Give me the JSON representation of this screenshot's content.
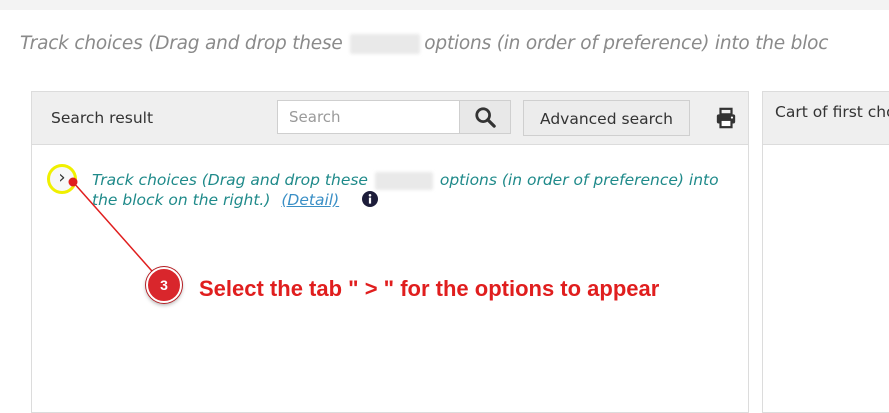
{
  "header": {
    "instruction_before": "Track choices (Drag and drop these",
    "instruction_after": "options (in order of preference) into the bloc"
  },
  "left_panel": {
    "title": "Search result",
    "search_placeholder": "Search",
    "advanced_search_label": "Advanced search"
  },
  "right_panel": {
    "title": "Cart of first cho"
  },
  "tree": {
    "expander_glyph": "›",
    "item_text_before": "Track choices (Drag and drop these",
    "item_text_after": "options (in order of preference) into the block on the right.)",
    "detail_link": "(Detail)"
  },
  "annotation": {
    "step_number": "3",
    "text": "Select the tab \" > \" for the options to appear",
    "color": "#e01e1e",
    "highlight_color": "#f0f000"
  },
  "icons": {
    "search": "search-icon",
    "print": "print-icon",
    "info": "info-icon"
  }
}
